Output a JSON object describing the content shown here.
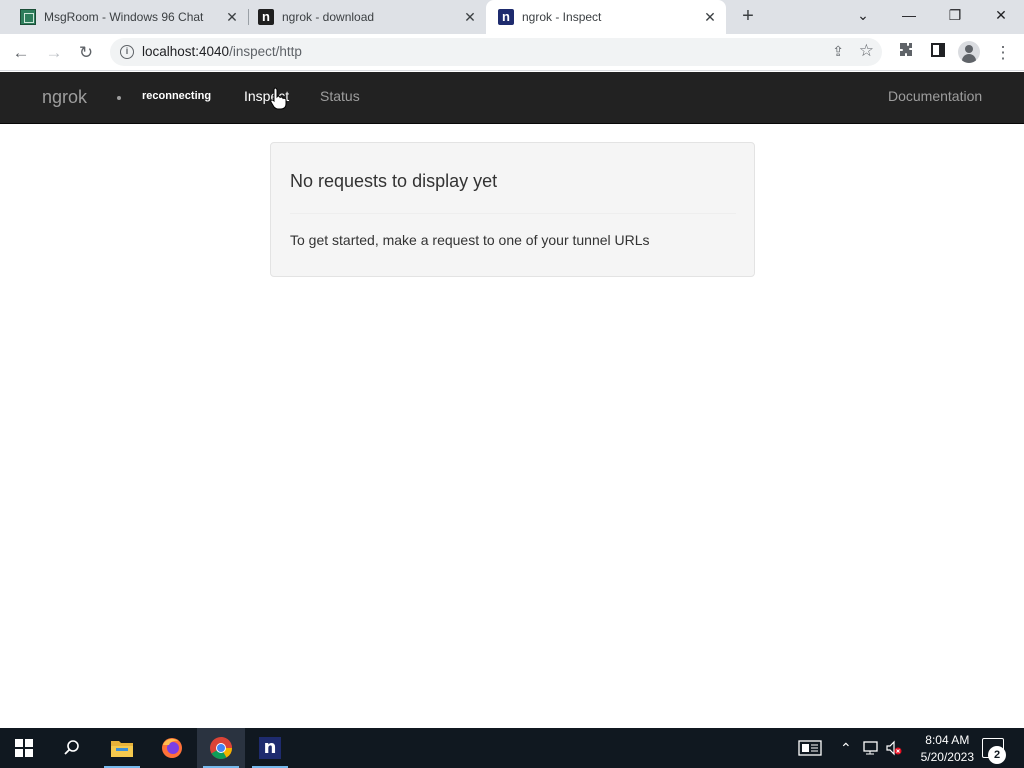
{
  "browser": {
    "tabs": [
      {
        "title": "MsgRoom - Windows 96 Chat",
        "favicon": "msgroom-icon",
        "active": false
      },
      {
        "title": "ngrok - download",
        "favicon": "ngrok-icon",
        "active": false
      },
      {
        "title": "ngrok - Inspect",
        "favicon": "ngrok-icon",
        "active": true
      }
    ],
    "new_tab_label": "+",
    "address_host": "localhost:4040",
    "address_path": "/inspect/http"
  },
  "navbar": {
    "brand": "ngrok",
    "connection_status": "reconnecting",
    "links": [
      "Inspect",
      "Status"
    ],
    "active_link": "Inspect",
    "right_link": "Documentation"
  },
  "panel": {
    "heading": "No requests to display yet",
    "message": "To get started, make a request to one of your tunnel URLs"
  },
  "taskbar": {
    "pinned": [
      "windows-start",
      "search",
      "file-explorer",
      "firefox",
      "chrome",
      "ngrok"
    ],
    "active_app": "chrome",
    "clock_time": "8:04 AM",
    "clock_date": "5/20/2023",
    "notification_count": "2"
  },
  "colors": {
    "navbar_bg": "#222222",
    "navbar_text": "#9d9d9d",
    "panel_bg": "#f5f5f5",
    "tabstrip_bg": "#dee1e6",
    "taskbar_bg": "#101820"
  }
}
